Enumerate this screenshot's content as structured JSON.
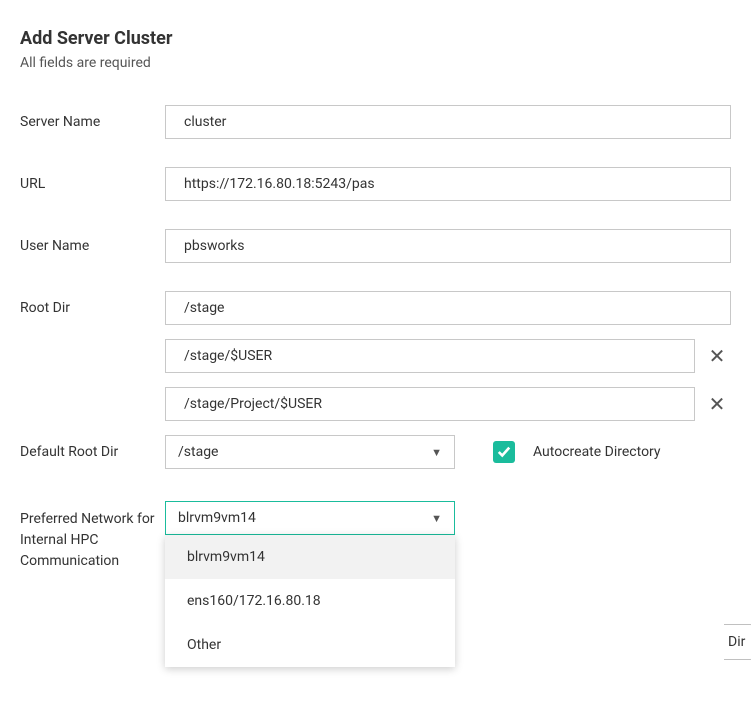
{
  "header": {
    "title": "Add Server Cluster",
    "subtitle": "All fields are required"
  },
  "fields": {
    "server_name": {
      "label": "Server Name",
      "value": "cluster"
    },
    "url": {
      "label": "URL",
      "value": "https://172.16.80.18:5243/pas"
    },
    "user_name": {
      "label": "User Name",
      "value": "pbsworks"
    },
    "root_dir": {
      "label": "Root Dir",
      "value": "/stage"
    },
    "extra_dirs": [
      "/stage/$USER",
      "/stage/Project/$USER"
    ],
    "default_root_dir": {
      "label": "Default Root Dir",
      "value": "/stage"
    },
    "autocreate": {
      "label": "Autocreate Directory",
      "checked": true
    },
    "preferred_network": {
      "label": "Preferred Network for Internal HPC Communication",
      "value": "blrvm9vm14",
      "options": [
        "blrvm9vm14",
        "ens160/172.16.80.18",
        "Other"
      ]
    }
  },
  "buttons": {
    "partial_visible": "Dir"
  }
}
